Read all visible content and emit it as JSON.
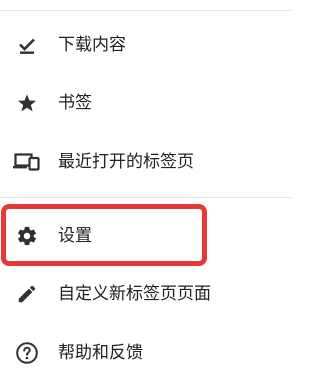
{
  "menu": {
    "items": [
      {
        "label": "下载内容",
        "icon": "download-done-icon"
      },
      {
        "label": "书签",
        "icon": "star-icon"
      },
      {
        "label": "最近打开的标签页",
        "icon": "devices-icon"
      },
      {
        "label": "设置",
        "icon": "gear-icon"
      },
      {
        "label": "自定义新标签页页面",
        "icon": "pencil-icon"
      },
      {
        "label": "帮助和反馈",
        "icon": "help-icon"
      }
    ]
  },
  "colors": {
    "text": "#202124",
    "icon": "#303134",
    "divider": "#e3e3e3",
    "highlight": "#e53935"
  }
}
